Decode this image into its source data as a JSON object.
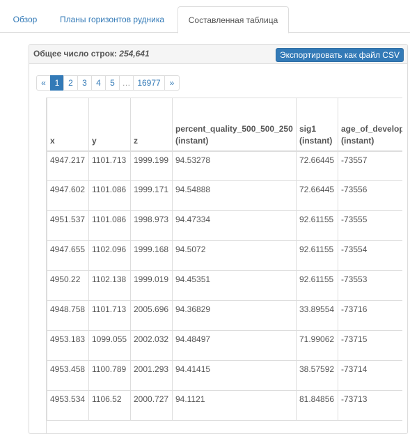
{
  "tabs": [
    {
      "label": "Обзор"
    },
    {
      "label": "Планы горизонтов рудника"
    },
    {
      "label": "Составленная таблица"
    }
  ],
  "panel": {
    "row_count_label": "Общее число строк:",
    "row_count_value": "254,641",
    "export_label": "Экспортировать как файл CSV"
  },
  "pagination": [
    "«",
    "1",
    "2",
    "3",
    "4",
    "5",
    "…",
    "16977",
    "»"
  ],
  "table": {
    "headers": [
      {
        "line1": "",
        "line2": "x"
      },
      {
        "line1": "",
        "line2": "y"
      },
      {
        "line1": "",
        "line2": "z"
      },
      {
        "line1": "percent_quality_500_500_250",
        "line2": "(instant)"
      },
      {
        "line1": "sig1",
        "line2": "(instant)"
      },
      {
        "line1": "age_of_development",
        "line2": "(instant)"
      }
    ],
    "rows": [
      [
        "4947.217",
        "1101.713",
        "1999.199",
        "94.53278",
        "72.66445",
        "-73557"
      ],
      [
        "4947.602",
        "1101.086",
        "1999.171",
        "94.54888",
        "72.66445",
        "-73556"
      ],
      [
        "4951.537",
        "1101.086",
        "1998.973",
        "94.47334",
        "92.61155",
        "-73555"
      ],
      [
        "4947.655",
        "1102.096",
        "1999.168",
        "94.5072",
        "92.61155",
        "-73554"
      ],
      [
        "4950.22",
        "1102.138",
        "1999.019",
        "94.45351",
        "92.61155",
        "-73553"
      ],
      [
        "4948.758",
        "1101.713",
        "2005.696",
        "94.36829",
        "33.89554",
        "-73716"
      ],
      [
        "4953.183",
        "1099.055",
        "2002.032",
        "94.48497",
        "71.99062",
        "-73715"
      ],
      [
        "4953.458",
        "1100.789",
        "2001.293",
        "94.41415",
        "38.57592",
        "-73714"
      ],
      [
        "4953.534",
        "1106.52",
        "2000.727",
        "94.1121",
        "81.84856",
        "-73713"
      ]
    ]
  }
}
